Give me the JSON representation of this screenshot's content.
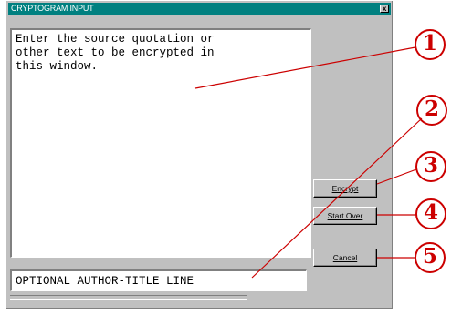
{
  "window": {
    "title": "CRYPTOGRAM INPUT",
    "close_glyph": "x"
  },
  "source_text": {
    "value": "Enter the source quotation or\nother text to be encrypted in\nthis window."
  },
  "author_field": {
    "value": "OPTIONAL AUTHOR-TITLE LINE"
  },
  "buttons": {
    "encrypt": "Encrypt",
    "start_over": "Start Over",
    "cancel": "Cancel"
  },
  "callouts": [
    "①",
    "②",
    "③",
    "④",
    "⑤"
  ],
  "colors": {
    "title_bar": "#008080",
    "face": "#c0c0c0",
    "callout": "#cc0000"
  }
}
